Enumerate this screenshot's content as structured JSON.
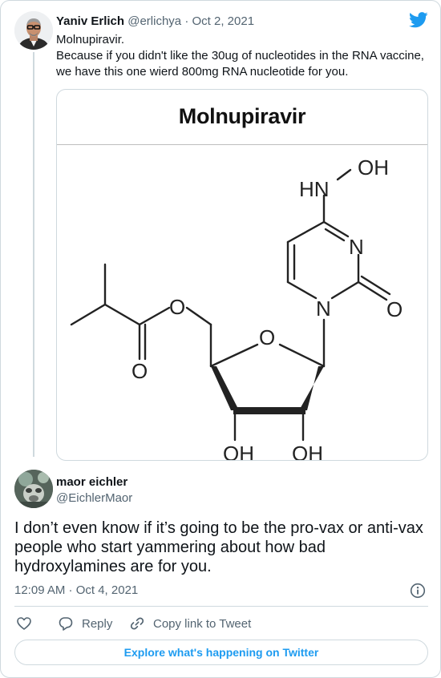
{
  "quoted_tweet": {
    "author_name": "Yaniv Erlich",
    "author_handle": "@erlichya",
    "separator": "·",
    "date": "Oct 2, 2021",
    "text_lines": [
      "Molnupiravir.",
      "Because if you didn't like the 30ug of nucleotides in the RNA vaccine,",
      "we have this one wierd 800mg RNA nucleotide for you."
    ],
    "image": {
      "title": "Molnupiravir",
      "atom_labels": {
        "oh_top": "OH",
        "hn": "HN",
        "n_ring_upper": "N",
        "n_ring_lower": "N",
        "o_carbonyl_ring": "O",
        "o_ring": "O",
        "o_ester": "O",
        "o_carbonyl_ester": "O",
        "oh_left": "OH",
        "oh_right": "OH"
      }
    }
  },
  "tweet": {
    "author_name": "maor eichler",
    "author_handle": "@EichlerMaor",
    "text_lines": [
      "I don’t even know if it’s going to be the pro-vax or anti-vax",
      "people who start yammering about how bad",
      "hydroxylamines are for you."
    ],
    "timestamp": "12:09 AM · Oct 4, 2021"
  },
  "actions": {
    "reply_label": "Reply",
    "copy_link_label": "Copy link to Tweet"
  },
  "explore_button_label": "Explore what's happening on Twitter",
  "colors": {
    "accent": "#1d9bf0",
    "text_primary": "#0f1419",
    "text_secondary": "#536471",
    "border": "#cfd9de"
  },
  "icons": [
    "twitter-bird-icon",
    "info-icon",
    "heart-icon",
    "reply-icon",
    "link-icon"
  ]
}
